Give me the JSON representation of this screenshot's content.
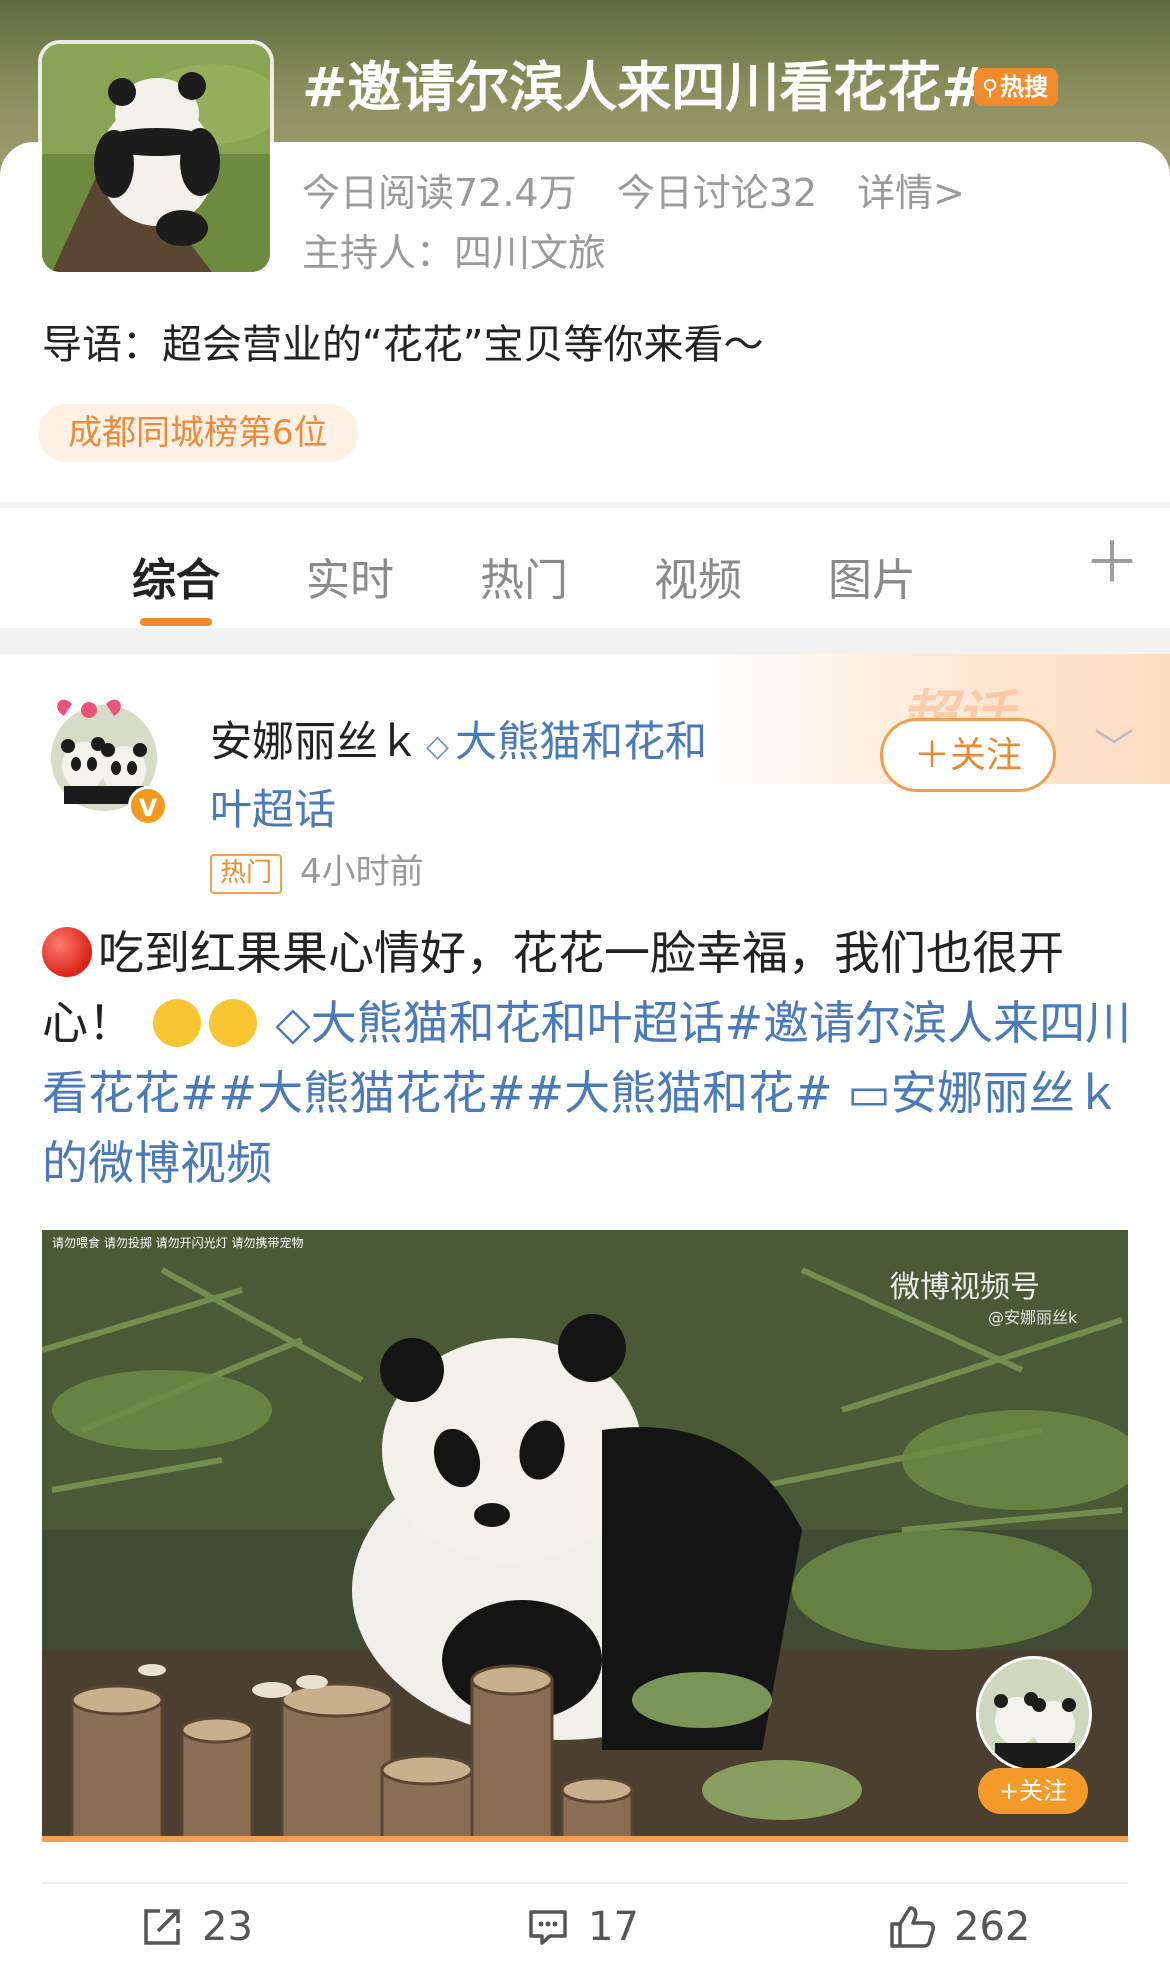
{
  "topic": {
    "title": "#邀请尔滨人来四川看花花#",
    "hot_badge": "热搜",
    "read_count": "今日阅读72.4万",
    "discuss_count": "今日讨论32",
    "details_link": "详情>",
    "host": "主持人：四川文旅",
    "intro": "导语：超会营业的“花花”宝贝等你来看～",
    "rank_badge": "成都同城榜第6位"
  },
  "tabs": [
    {
      "label": "综合",
      "active": true
    },
    {
      "label": "实时",
      "active": false
    },
    {
      "label": "热门",
      "active": false
    },
    {
      "label": "视频",
      "active": false
    },
    {
      "label": "图片",
      "active": false
    }
  ],
  "post": {
    "username": "安娜丽丝ｋ",
    "supertopic_line1": "大熊猫和花和",
    "supertopic_line2": "叶超话",
    "hot_tag": "热门",
    "time": "4小时前",
    "follow_label": "＋关注",
    "supertopic_banner": "超话",
    "text_part1": "吃到红果果心情好，花花一脸幸福，我们也很开心！",
    "link1": "大熊猫和花和叶超话",
    "link2": "#邀请尔滨人来四川看花花#",
    "link3": "#大熊猫花花#",
    "link4": "#大熊猫和花#",
    "link5": "安娜丽丝ｋ的微博视频",
    "video": {
      "watermark": "微博视频号",
      "watermark_sub": "@安娜丽丝k",
      "notice": "请勿喂食 请勿投掷 请勿开闪光灯 请勿携带宠物",
      "mini_follow": "+关注"
    },
    "actions": {
      "share_count": "23",
      "comment_count": "17",
      "like_count": "262"
    }
  },
  "colors": {
    "accent": "#f08b2e",
    "link": "#4a7ab8",
    "hero_top": "#5f6b3f"
  }
}
